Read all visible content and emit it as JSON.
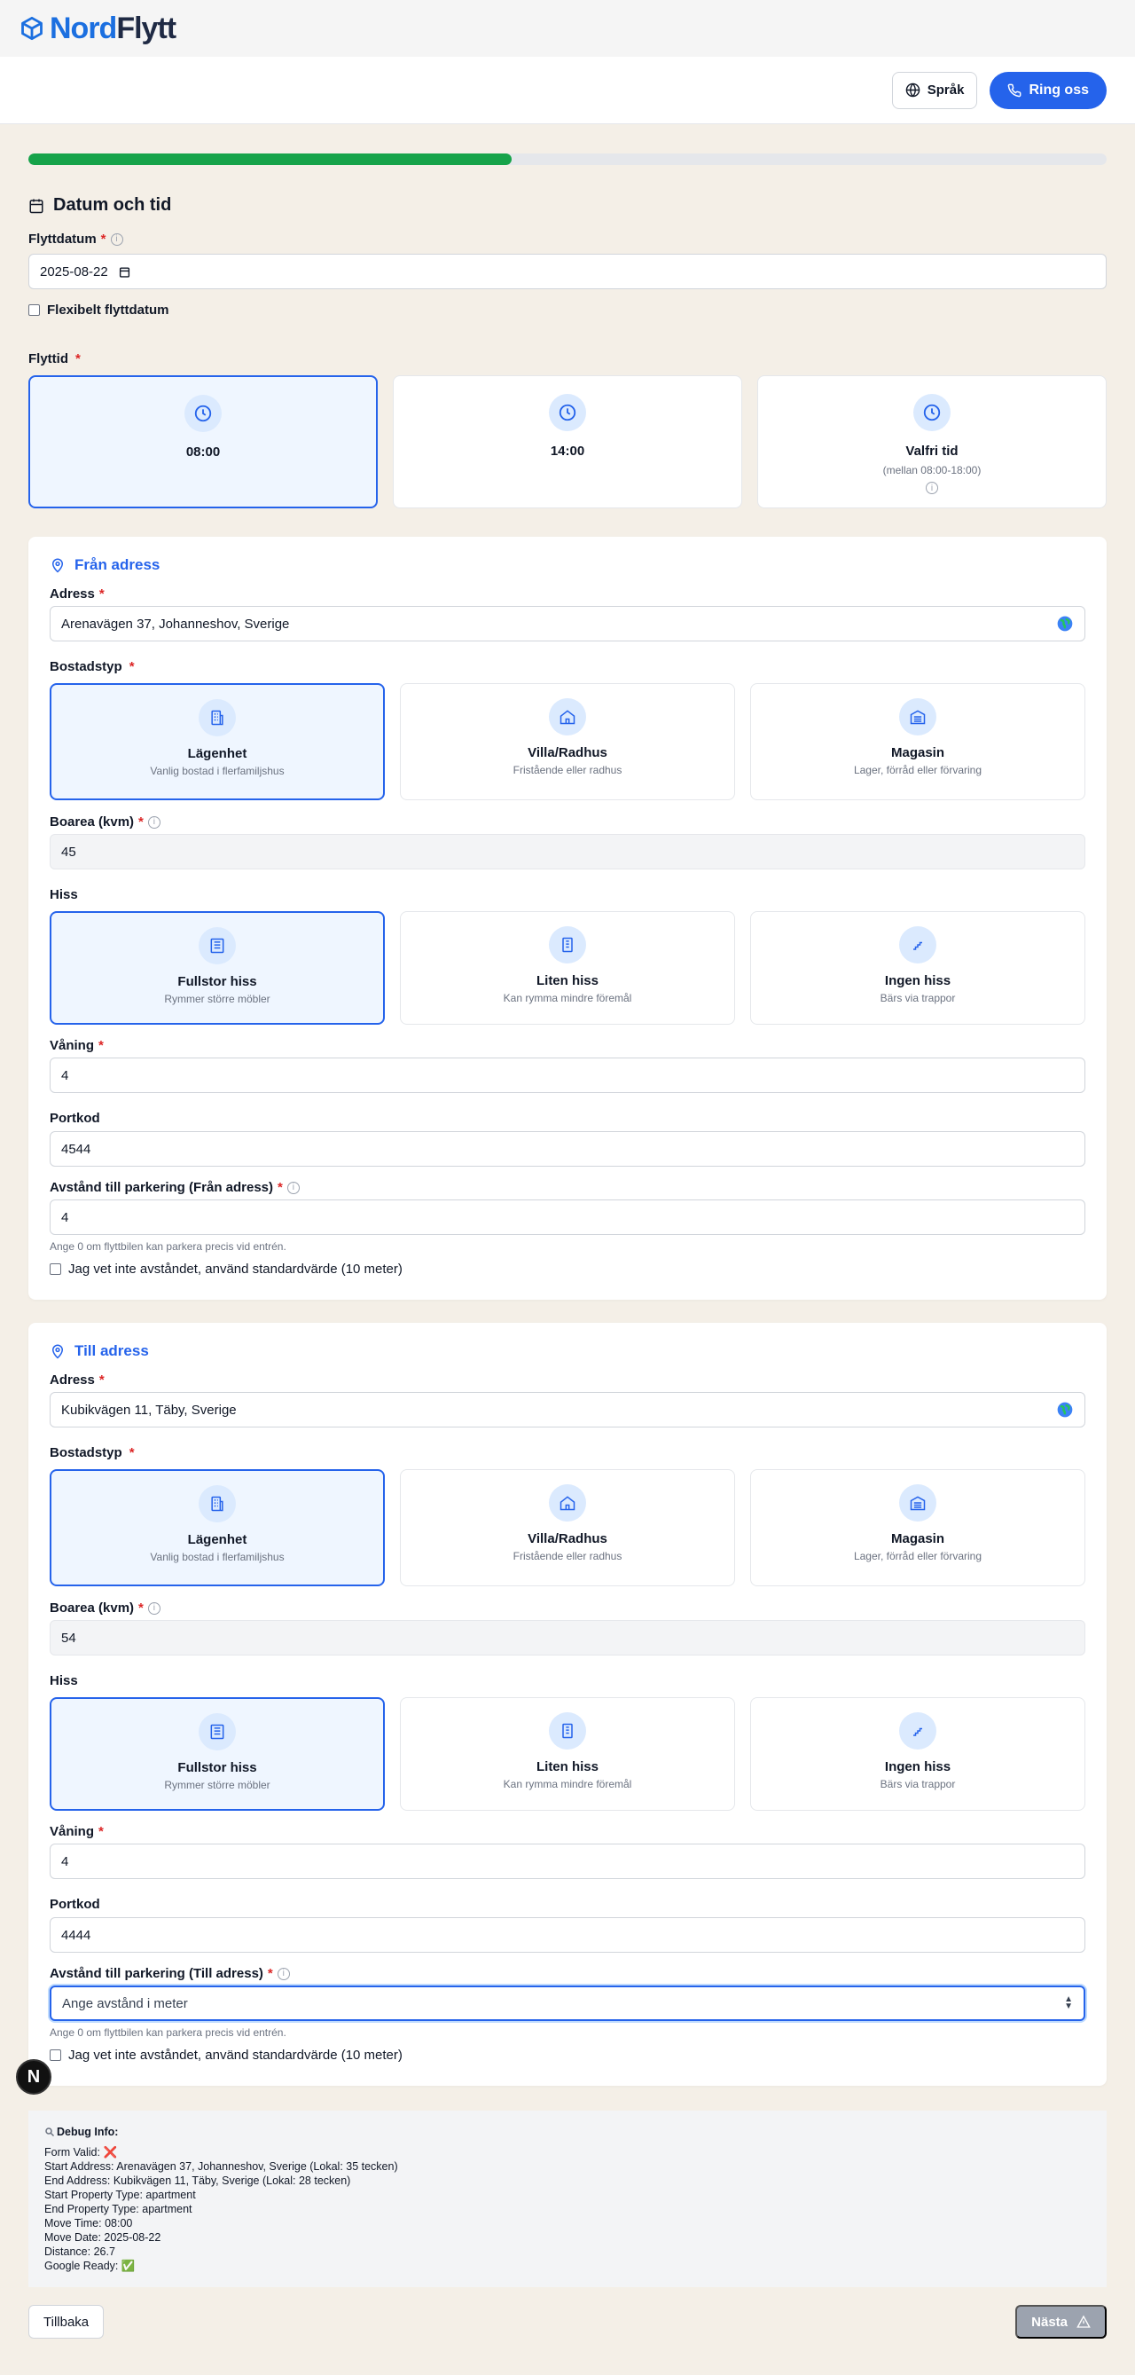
{
  "brand": {
    "nord": "Nord",
    "flytt": "Flytt",
    "accent": "#1b6fe0"
  },
  "header": {
    "lang_label": "Språk",
    "call_label": "Ring oss"
  },
  "progress": {
    "percent": 44.8,
    "color": "#16a34a"
  },
  "datetime": {
    "title": "Datum och tid",
    "date_label": "Flyttdatum",
    "date_value": "2025-08-22",
    "flexible_label": "Flexibelt flyttdatum",
    "time_label": "Flyttid",
    "times": [
      {
        "label": "08:00",
        "sub": "",
        "selected": true
      },
      {
        "label": "14:00",
        "sub": "",
        "selected": false
      },
      {
        "label": "Valfri tid",
        "sub": "(mellan 08:00-18:00)",
        "selected": false
      }
    ]
  },
  "from": {
    "title": "Från adress",
    "address_label": "Adress",
    "address_value": "Arenavägen 37, Johanneshov, Sverige",
    "type_label": "Bostadstyp",
    "types": [
      {
        "title": "Lägenhet",
        "sub": "Vanlig bostad i flerfamiljshus",
        "icon": "building-icon",
        "selected": true
      },
      {
        "title": "Villa/Radhus",
        "sub": "Fristående eller radhus",
        "icon": "house-icon",
        "selected": false
      },
      {
        "title": "Magasin",
        "sub": "Lager, förråd eller förvaring",
        "icon": "warehouse-icon",
        "selected": false
      }
    ],
    "area_label": "Boarea (kvm)",
    "area_value": "45",
    "lift_label": "Hiss",
    "lifts": [
      {
        "title": "Fullstor hiss",
        "sub": "Rymmer större möbler",
        "icon": "elevator-icon",
        "selected": true
      },
      {
        "title": "Liten hiss",
        "sub": "Kan rymma mindre föremål",
        "icon": "small-elevator-icon",
        "selected": false
      },
      {
        "title": "Ingen hiss",
        "sub": "Bärs via trappor",
        "icon": "stairs-icon",
        "selected": false
      }
    ],
    "floor_label": "Våning",
    "floor_value": "4",
    "code_label": "Portkod",
    "code_value": "4544",
    "distance_label": "Avstånd till parkering (Från adress)",
    "distance_value": "4",
    "distance_hint": "Ange 0 om flyttbilen kan parkera precis vid entrén.",
    "unknown_label": "Jag vet inte avståndet, använd standardvärde (10 meter)"
  },
  "to": {
    "title": "Till adress",
    "address_label": "Adress",
    "address_value": "Kubikvägen 11, Täby, Sverige",
    "type_label": "Bostadstyp",
    "types": [
      {
        "title": "Lägenhet",
        "sub": "Vanlig bostad i flerfamiljshus",
        "icon": "building-icon",
        "selected": true
      },
      {
        "title": "Villa/Radhus",
        "sub": "Fristående eller radhus",
        "icon": "house-icon",
        "selected": false
      },
      {
        "title": "Magasin",
        "sub": "Lager, förråd eller förvaring",
        "icon": "warehouse-icon",
        "selected": false
      }
    ],
    "area_label": "Boarea (kvm)",
    "area_value": "54",
    "lift_label": "Hiss",
    "lifts": [
      {
        "title": "Fullstor hiss",
        "sub": "Rymmer större möbler",
        "icon": "elevator-icon",
        "selected": true
      },
      {
        "title": "Liten hiss",
        "sub": "Kan rymma mindre föremål",
        "icon": "small-elevator-icon",
        "selected": false
      },
      {
        "title": "Ingen hiss",
        "sub": "Bärs via trappor",
        "icon": "stairs-icon",
        "selected": false
      }
    ],
    "floor_label": "Våning",
    "floor_value": "4",
    "code_label": "Portkod",
    "code_value": "4444",
    "distance_label": "Avstånd till parkering (Till adress)",
    "distance_placeholder": "Ange avstånd i meter",
    "distance_hint": "Ange 0 om flyttbilen kan parkera precis vid entrén.",
    "unknown_label": "Jag vet inte avståndet, använd standardvärde (10 meter)"
  },
  "debug": {
    "title": "Debug Info:",
    "lines": [
      "Form Valid: ❌",
      "Start Address: Arenavägen 37, Johanneshov, Sverige (Lokal: 35 tecken)",
      "End Address: Kubikvägen 11, Täby, Sverige (Lokal: 28 tecken)",
      "Start Property Type: apartment",
      "End Property Type: apartment",
      "Move Time: 08:00",
      "Move Date: 2025-08-22",
      "Distance: 26.7",
      "Google Ready: ✅"
    ]
  },
  "footer": {
    "back_label": "Tillbaka",
    "next_label": "Nästa"
  },
  "overlay": {
    "next_badge": "N"
  }
}
